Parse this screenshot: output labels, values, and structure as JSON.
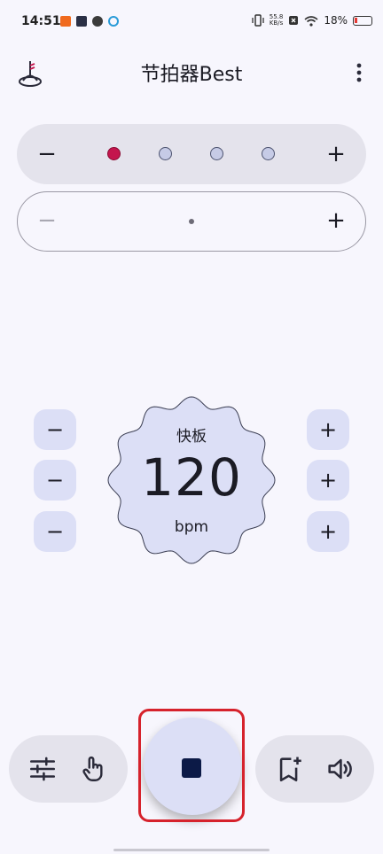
{
  "status_bar": {
    "time": "14:51",
    "net_speed_value": "55.8",
    "net_speed_unit": "KB/s",
    "battery": "18%",
    "battery_color": "#e53935"
  },
  "app_bar": {
    "title": "节拍器Best",
    "logo_icon": "metronome-logo-icon",
    "more_icon": "more-vertical-icon"
  },
  "beats": {
    "decrease_label": "−",
    "increase_label": "+",
    "dots": [
      "accent",
      "normal",
      "normal",
      "normal"
    ],
    "accent_color": "#c4154d"
  },
  "subdivision": {
    "decrease_label": "−",
    "increase_label": "+"
  },
  "tempo": {
    "name": "快板",
    "value": "120",
    "unit": "bpm",
    "minus_label": "−",
    "plus_label": "+"
  },
  "bottom_bar": {
    "left_icons": [
      "sliders-icon",
      "tap-tempo-icon"
    ],
    "right_icons": [
      "bookmark-add-icon",
      "volume-icon"
    ],
    "play_state": "stop"
  }
}
